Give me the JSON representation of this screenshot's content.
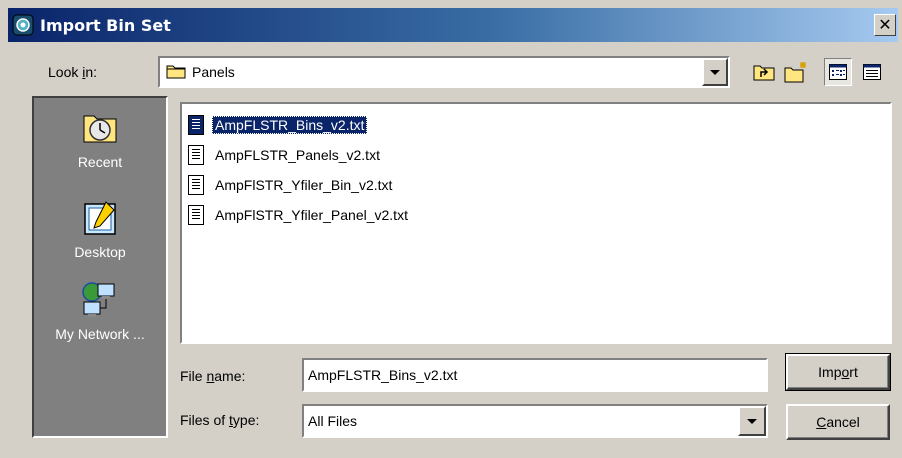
{
  "window": {
    "title": "Import Bin Set",
    "close_glyph": "✕"
  },
  "look_in": {
    "label_pre": "Look ",
    "label_mnemonic": "i",
    "label_post": "n:",
    "value": "Panels",
    "icon": "folder-icon"
  },
  "toolbar": {
    "icons": [
      "up-one-level-icon",
      "new-folder-icon",
      "list-view-icon",
      "details-view-icon"
    ]
  },
  "places": [
    {
      "label": "Recent",
      "icon": "recent-icon"
    },
    {
      "label": "Desktop",
      "icon": "desktop-icon"
    },
    {
      "label": "My Network ...",
      "icon": "network-icon"
    }
  ],
  "files": [
    {
      "name": "AmpFLSTR_Bins_v2.txt",
      "selected": true
    },
    {
      "name": "AmpFLSTR_Panels_v2.txt",
      "selected": false
    },
    {
      "name": "AmpFlSTR_Yfiler_Bin_v2.txt",
      "selected": false
    },
    {
      "name": "AmpFlSTR_Yfiler_Panel_v2.txt",
      "selected": false
    }
  ],
  "file_name": {
    "label_pre": "File ",
    "label_mnemonic": "n",
    "label_post": "ame:",
    "value": "AmpFLSTR_Bins_v2.txt"
  },
  "file_type": {
    "label_pre": "Files of ",
    "label_mnemonic": "t",
    "label_post": "ype:",
    "value": "All Files"
  },
  "buttons": {
    "import_pre": "Imp",
    "import_mnemonic": "o",
    "import_post": "rt",
    "cancel_mnemonic": "C",
    "cancel_post": "ancel"
  },
  "colors": {
    "title_gradient_start": "#0a246a",
    "selection": "#0a246a",
    "dialog_bg": "#d4d0c8",
    "places_bg": "#808080"
  }
}
